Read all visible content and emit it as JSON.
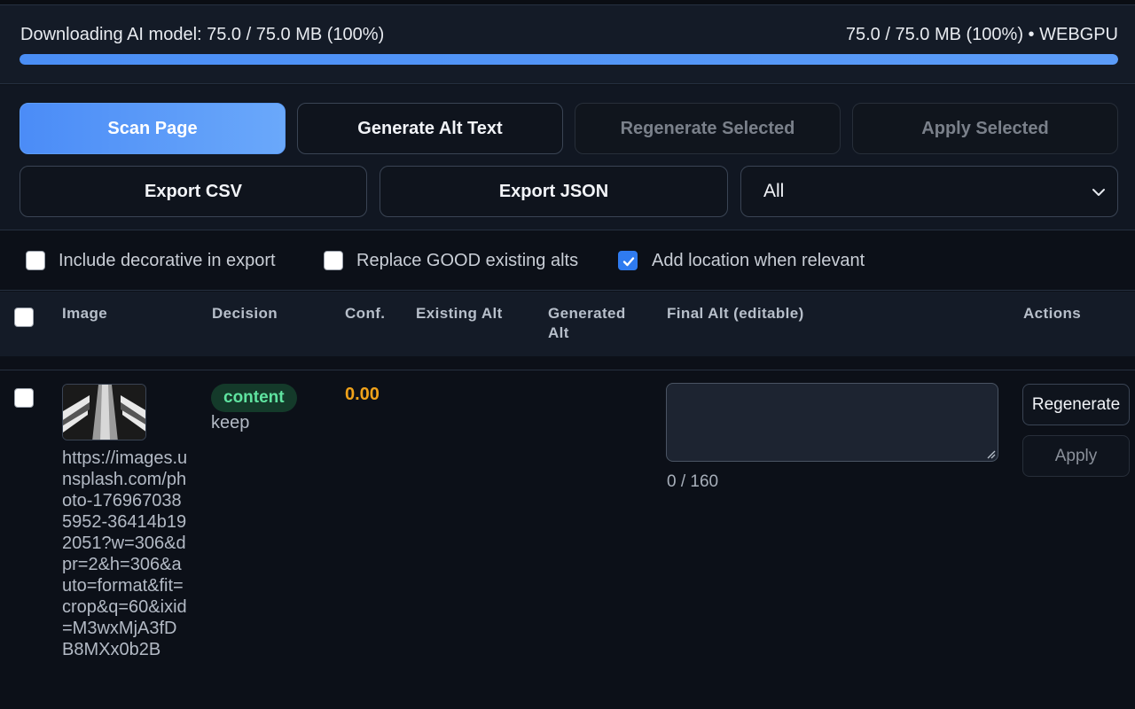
{
  "progress": {
    "label": "Downloading AI model: 75.0 / 75.0 MB (100%)",
    "right": "75.0 / 75.0 MB (100%) • WEBGPU",
    "percent": 100
  },
  "toolbar": {
    "scan": "Scan Page",
    "generate": "Generate Alt Text",
    "regenerate_selected": "Regenerate Selected",
    "apply_selected": "Apply Selected",
    "export_csv": "Export CSV",
    "export_json": "Export JSON",
    "filter_value": "All"
  },
  "options": {
    "include_decorative": "Include decorative in export",
    "replace_good": "Replace GOOD existing alts",
    "add_location": "Add location when relevant",
    "include_decorative_checked": false,
    "replace_good_checked": false,
    "add_location_checked": true
  },
  "table": {
    "headers": [
      "Image",
      "Decision",
      "Conf.",
      "Existing Alt",
      "Generated Alt",
      "Final Alt (editable)",
      "Actions"
    ],
    "rows": [
      {
        "url": "https://images.unsplash.com/photo-1769670385952-36414b192051?w=306&dpr=2&h=306&auto=format&fit=crop&q=60&ixid=M3wxMjA3fDB8MXx0b2B",
        "decision": "content",
        "decision_action": "keep",
        "confidence": "0.00",
        "existing_alt": "",
        "generated_alt": "",
        "final_alt": "",
        "char_count": "0 / 160",
        "regenerate": "Regenerate",
        "apply": "Apply"
      }
    ]
  },
  "colors": {
    "accent": "#4b8cf7",
    "badge_text": "#5fe3a0",
    "confidence": "#f0a21a"
  }
}
